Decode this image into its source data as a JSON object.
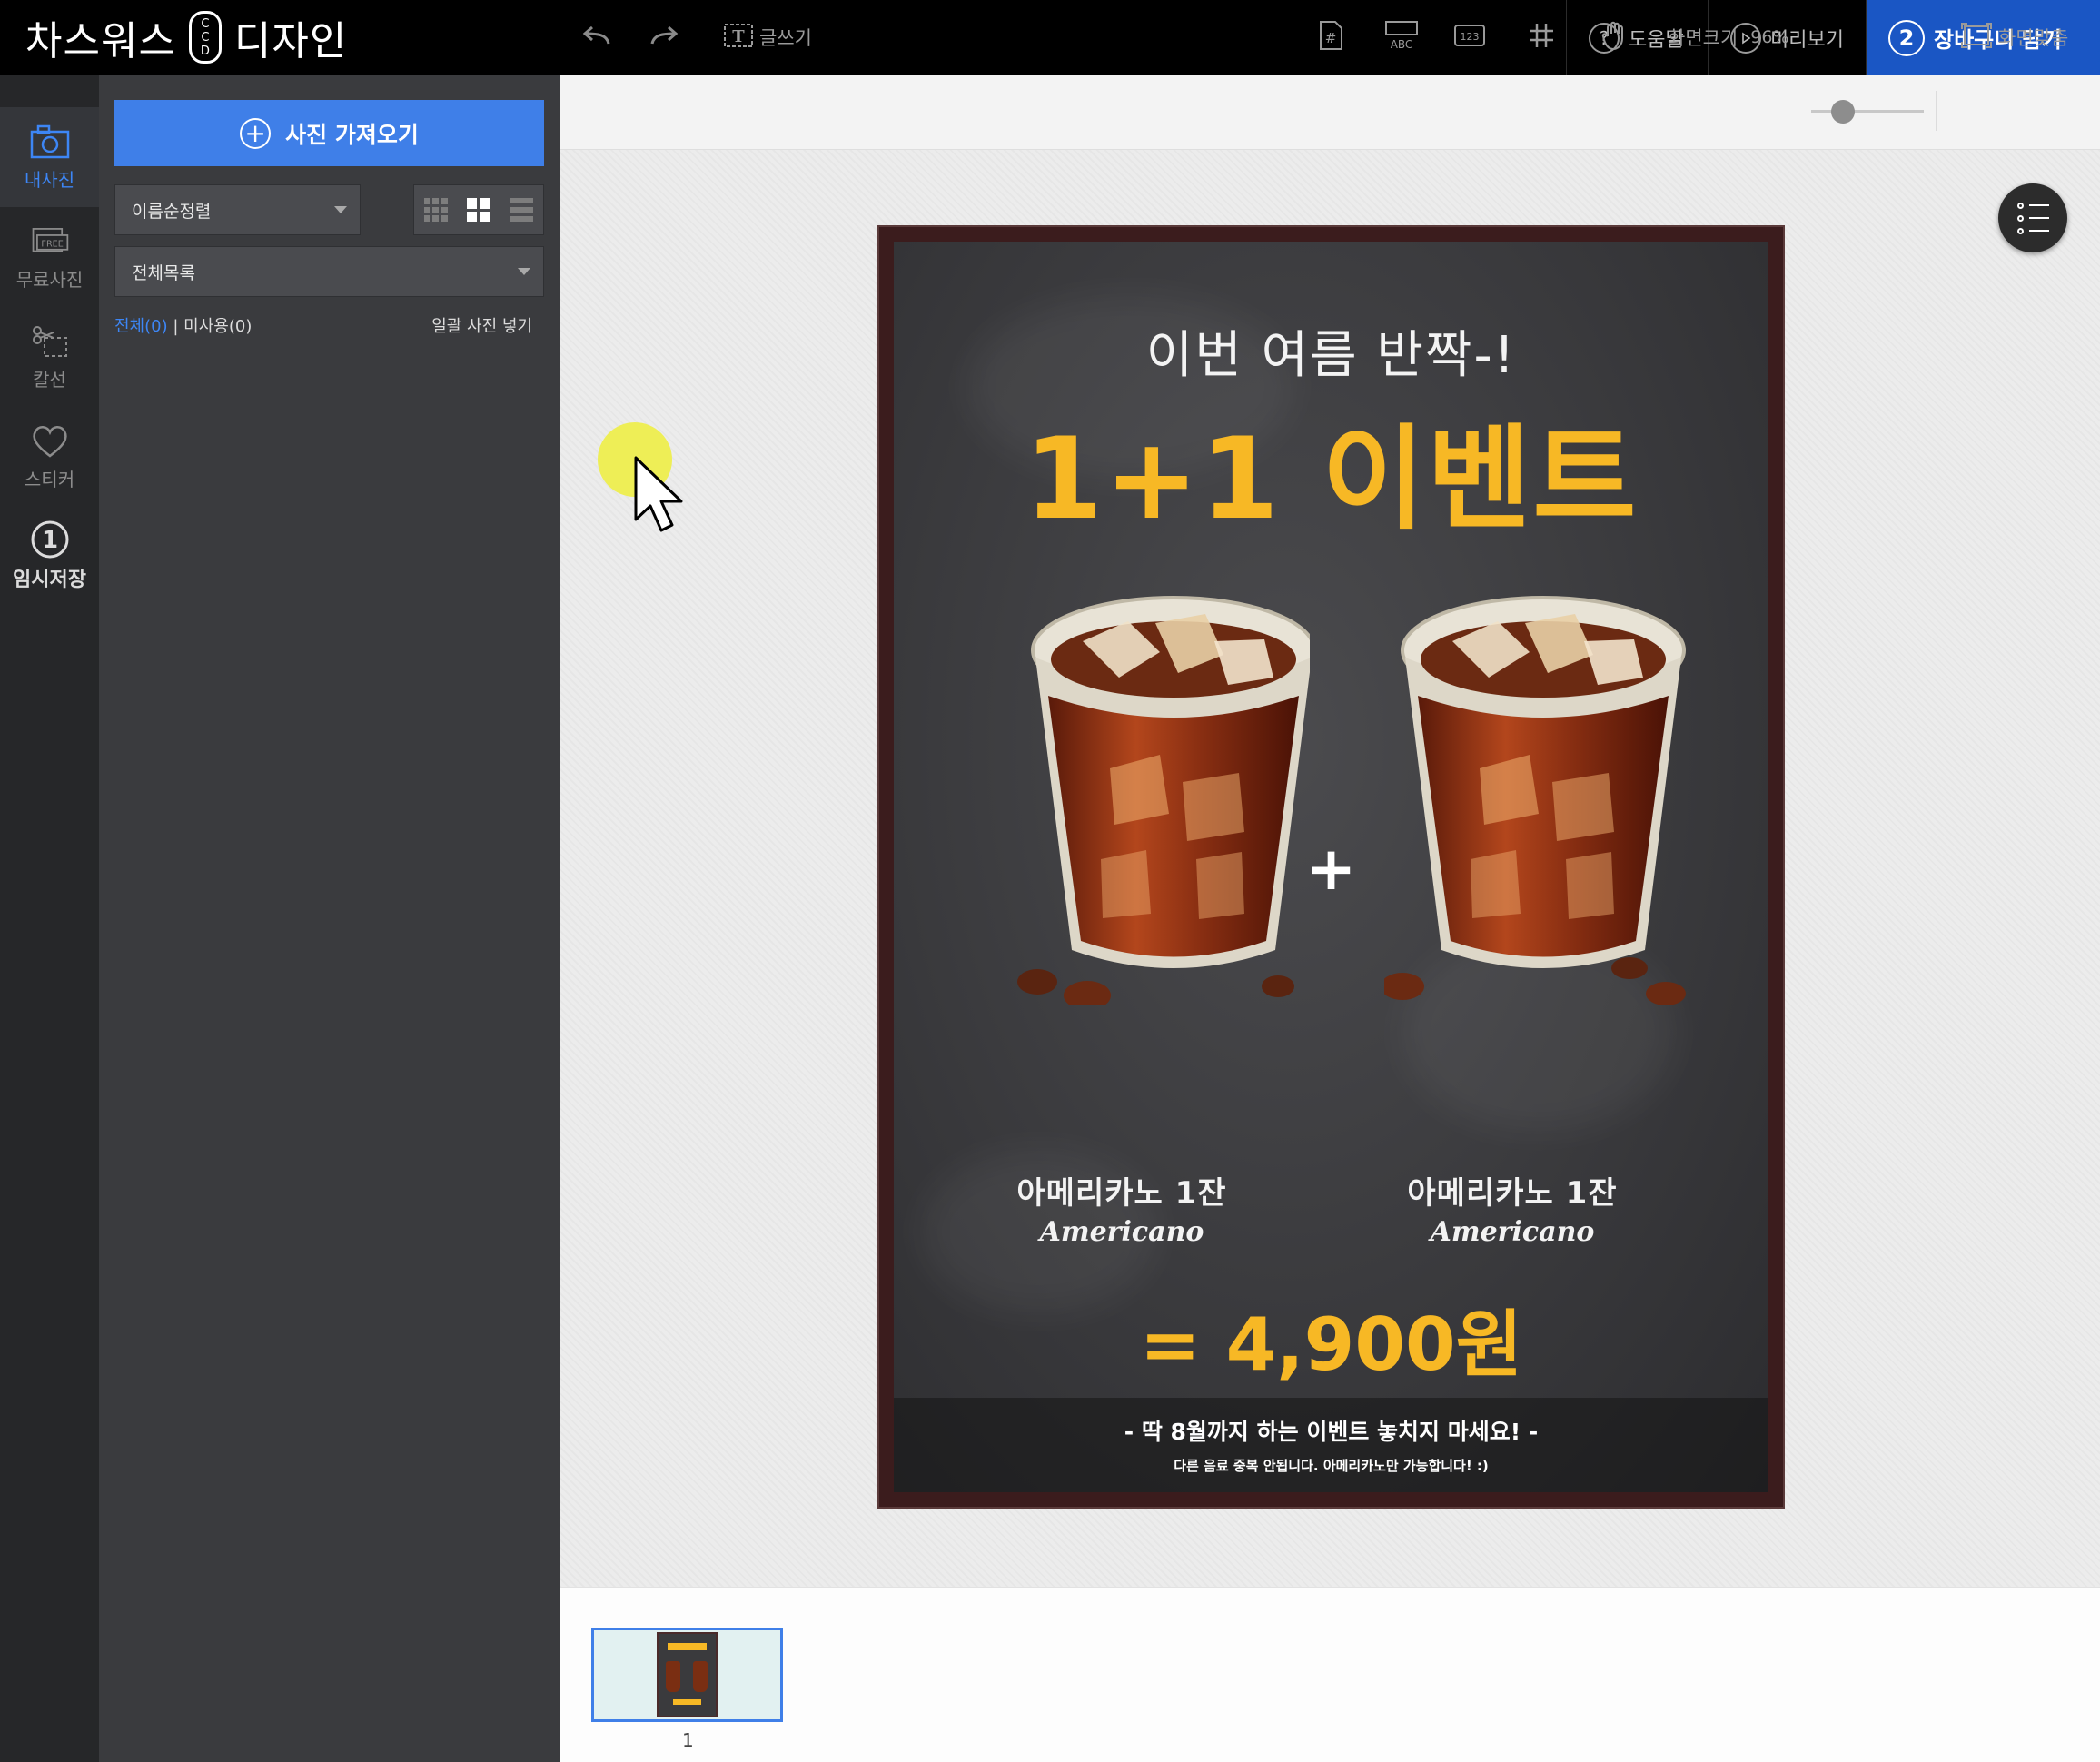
{
  "app": {
    "brand_left": "차스워스",
    "brand_logo": [
      "C",
      "C",
      "D"
    ],
    "brand_right": "디자인"
  },
  "topbar": {
    "help_label": "도움말",
    "preview_label": "미리보기",
    "cart_step": "2",
    "cart_label": "장바구니 담기"
  },
  "rail": {
    "items": [
      {
        "label": "내사진",
        "icon": "camera-icon"
      },
      {
        "label": "무료사진",
        "icon": "free-photo-icon"
      },
      {
        "label": "칼선",
        "icon": "scissors-icon"
      },
      {
        "label": "스티커",
        "icon": "heart-icon"
      },
      {
        "label": "임시저장",
        "icon": "temp-save-icon",
        "number": "1"
      }
    ]
  },
  "panel": {
    "import_label": "사진 가져오기",
    "sort_value": "이름순정렬",
    "list_value": "전체목록",
    "filter_all": "전체(0)",
    "filter_sep": "|",
    "filter_unused": "미사용(0)",
    "bulk_insert": "일괄 사진 넣기"
  },
  "toolbar": {
    "write_label": "글쓰기",
    "zoom_label": "화면크기",
    "zoom_value": "96%",
    "zoom_level": 0.48,
    "fit_label": "화면맞춤"
  },
  "poster": {
    "subtitle": "이번 여름 반짝-!",
    "title": "1+1 이벤트",
    "plus": "+",
    "left_ko": "아메리카노 1잔",
    "left_en": "Americano",
    "right_ko": "아메리카노 1잔",
    "right_en": "Americano",
    "price": "= 4,900원",
    "footer_line1": "- 딱 8월까지 하는 이벤트 놓치지 마세요! -",
    "footer_line2": "다른 음료 중복 안됩니다. 아메리카노만 가능합니다! :)"
  },
  "pages": {
    "thumb_number": "1"
  },
  "colors": {
    "accent_blue": "#3f7fe8",
    "cart_blue": "#1a56c4",
    "poster_yellow": "#f7b825"
  }
}
